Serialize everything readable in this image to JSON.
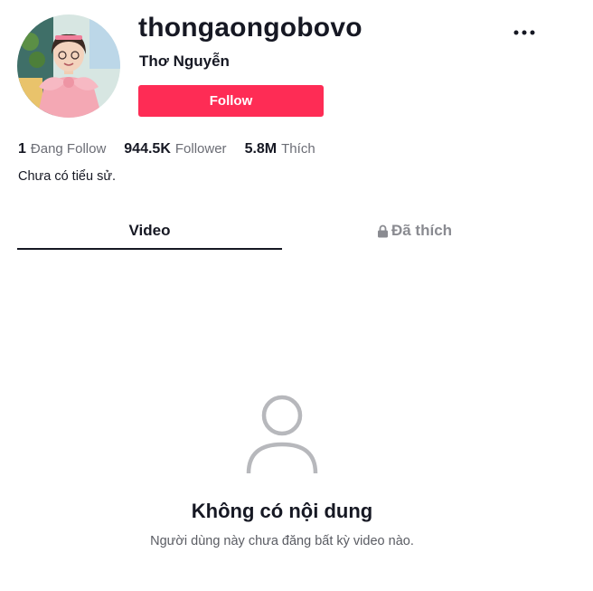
{
  "profile": {
    "username": "thongaongobovo",
    "nickname": "Thơ Nguyễn",
    "follow_label": "Follow",
    "bio": "Chưa có tiểu sử."
  },
  "stats": [
    {
      "count": "1",
      "label": "Đang Follow"
    },
    {
      "count": "944.5K",
      "label": "Follower"
    },
    {
      "count": "5.8M",
      "label": "Thích"
    }
  ],
  "tabs": {
    "video_label": "Video",
    "liked_label": "Đã thích",
    "liked_icon": "lock-icon"
  },
  "empty_state": {
    "icon": "user-icon",
    "title": "Không có nội dung",
    "description": "Người dùng này chưa đăng bất kỳ video nào."
  },
  "menu": {
    "icon": "more-icon"
  },
  "colors": {
    "accent": "#fe2c55",
    "text": "#161823",
    "muted": "#8a8b91"
  }
}
